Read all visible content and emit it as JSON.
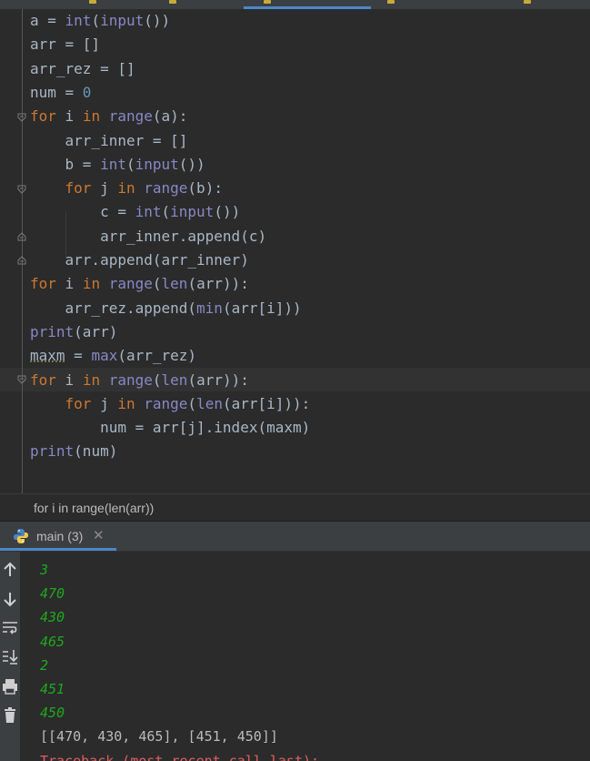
{
  "editor": {
    "lines": [
      [
        {
          "t": "a = "
        },
        {
          "t": "int",
          "c": "bi"
        },
        {
          "t": "("
        },
        {
          "t": "input",
          "c": "bi"
        },
        {
          "t": "())"
        }
      ],
      [
        {
          "t": "arr = []"
        }
      ],
      [
        {
          "t": "arr_rez = []"
        }
      ],
      [
        {
          "t": "num = "
        },
        {
          "t": "0",
          "c": "num"
        }
      ],
      [
        {
          "t": "for",
          "c": "kw"
        },
        {
          "t": " i "
        },
        {
          "t": "in",
          "c": "kw"
        },
        {
          "t": " "
        },
        {
          "t": "range",
          "c": "bi"
        },
        {
          "t": "(a):"
        }
      ],
      [
        {
          "t": "    arr_inner = []"
        }
      ],
      [
        {
          "t": "    b = "
        },
        {
          "t": "int",
          "c": "bi"
        },
        {
          "t": "("
        },
        {
          "t": "input",
          "c": "bi"
        },
        {
          "t": "())"
        }
      ],
      [
        {
          "t": "    "
        },
        {
          "t": "for",
          "c": "kw"
        },
        {
          "t": " j "
        },
        {
          "t": "in",
          "c": "kw"
        },
        {
          "t": " "
        },
        {
          "t": "range",
          "c": "bi"
        },
        {
          "t": "(b):"
        }
      ],
      [
        {
          "t": "        c = "
        },
        {
          "t": "int",
          "c": "bi"
        },
        {
          "t": "("
        },
        {
          "t": "input",
          "c": "bi"
        },
        {
          "t": "())"
        }
      ],
      [
        {
          "t": "        arr_inner.append(c)"
        }
      ],
      [
        {
          "t": "    arr.append(arr_inner)"
        }
      ],
      [
        {
          "t": "for",
          "c": "kw"
        },
        {
          "t": " i "
        },
        {
          "t": "in",
          "c": "kw"
        },
        {
          "t": " "
        },
        {
          "t": "range",
          "c": "bi"
        },
        {
          "t": "("
        },
        {
          "t": "len",
          "c": "bi"
        },
        {
          "t": "(arr)):"
        }
      ],
      [
        {
          "t": "    arr_rez.append("
        },
        {
          "t": "min",
          "c": "bi"
        },
        {
          "t": "(arr[i]))"
        }
      ],
      [
        {
          "t": "print",
          "c": "bi"
        },
        {
          "t": "(arr)"
        }
      ],
      [
        {
          "t": "maxm",
          "c": "und"
        },
        {
          "t": " = "
        },
        {
          "t": "max",
          "c": "bi"
        },
        {
          "t": "(arr_rez)"
        }
      ],
      [
        {
          "t": "for",
          "c": "kw"
        },
        {
          "t": " i "
        },
        {
          "t": "in",
          "c": "kw"
        },
        {
          "t": " "
        },
        {
          "t": "range",
          "c": "bi"
        },
        {
          "t": "("
        },
        {
          "t": "len",
          "c": "bi"
        },
        {
          "t": "(arr)):"
        }
      ],
      [
        {
          "t": "    "
        },
        {
          "t": "for",
          "c": "kw"
        },
        {
          "t": " j "
        },
        {
          "t": "in",
          "c": "kw"
        },
        {
          "t": " "
        },
        {
          "t": "range",
          "c": "bi"
        },
        {
          "t": "("
        },
        {
          "t": "len",
          "c": "bi"
        },
        {
          "t": "(arr[i])):"
        }
      ],
      [
        {
          "t": "        num = arr[j].index(maxm)"
        }
      ],
      [
        {
          "t": "print",
          "c": "bi"
        },
        {
          "t": "(num)"
        }
      ]
    ]
  },
  "breadcrumb": {
    "text": "for i in range(len(arr))"
  },
  "run_panel": {
    "tab_label": "main (3)",
    "close_glyph": "✕"
  },
  "console": {
    "lines": [
      {
        "text": "3",
        "kind": "input"
      },
      {
        "text": "470",
        "kind": "input"
      },
      {
        "text": "430",
        "kind": "input"
      },
      {
        "text": "465",
        "kind": "input"
      },
      {
        "text": "2",
        "kind": "input"
      },
      {
        "text": "451",
        "kind": "input"
      },
      {
        "text": "450",
        "kind": "input"
      },
      {
        "text": "[[470, 430, 465], [451, 450]]",
        "kind": "output"
      },
      {
        "text": "Traceback (most recent call last):",
        "kind": "error"
      }
    ]
  },
  "colors": {
    "keyword": "#cc7832",
    "builtin": "#8888c6",
    "number": "#6897bb",
    "input_text": "#1ea81e",
    "error_text": "#e05d5d",
    "accent": "#4a88c7"
  }
}
